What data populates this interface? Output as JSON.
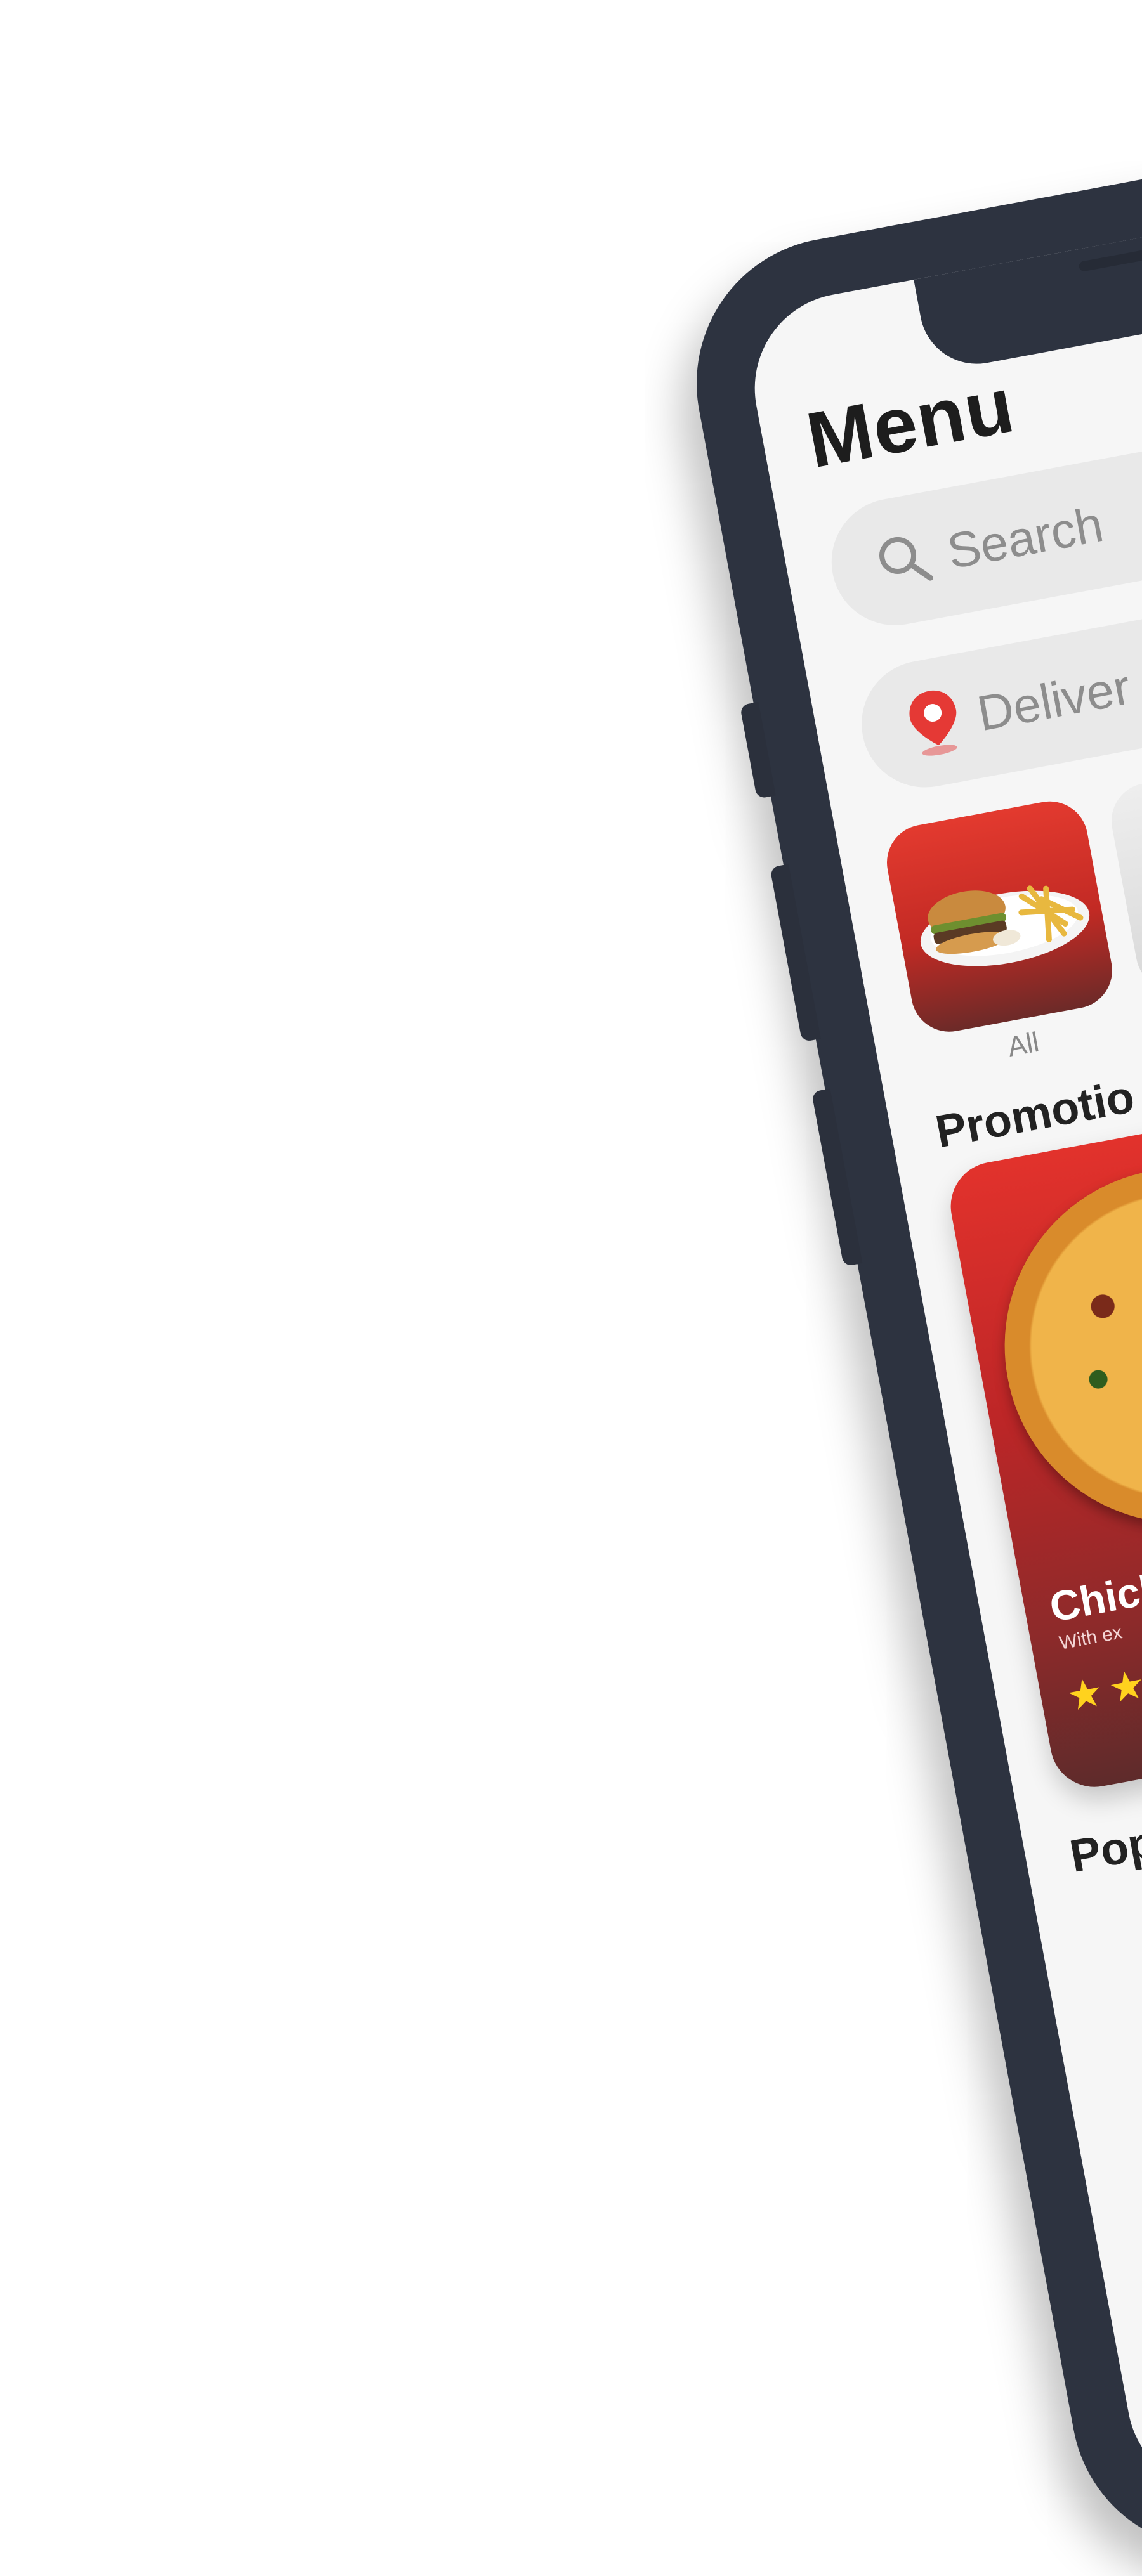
{
  "header": {
    "title": "Menu"
  },
  "search": {
    "placeholder": "Search"
  },
  "delivery": {
    "label": "Deliver"
  },
  "categories": [
    {
      "label": "All",
      "icon": "burger-fries-image"
    },
    {
      "label": "",
      "icon": "food-image"
    }
  ],
  "promotions": {
    "heading": "Promotio",
    "card": {
      "name": "Chick",
      "subtitle": "With ex",
      "rating": 2,
      "accent": "#d32f2f"
    }
  },
  "popular": {
    "heading": "Pop"
  },
  "colors": {
    "phone_frame": "#2d3340",
    "screen_bg": "#f6f6f6",
    "accent_red": "#e53935",
    "star": "#ffd21e"
  }
}
